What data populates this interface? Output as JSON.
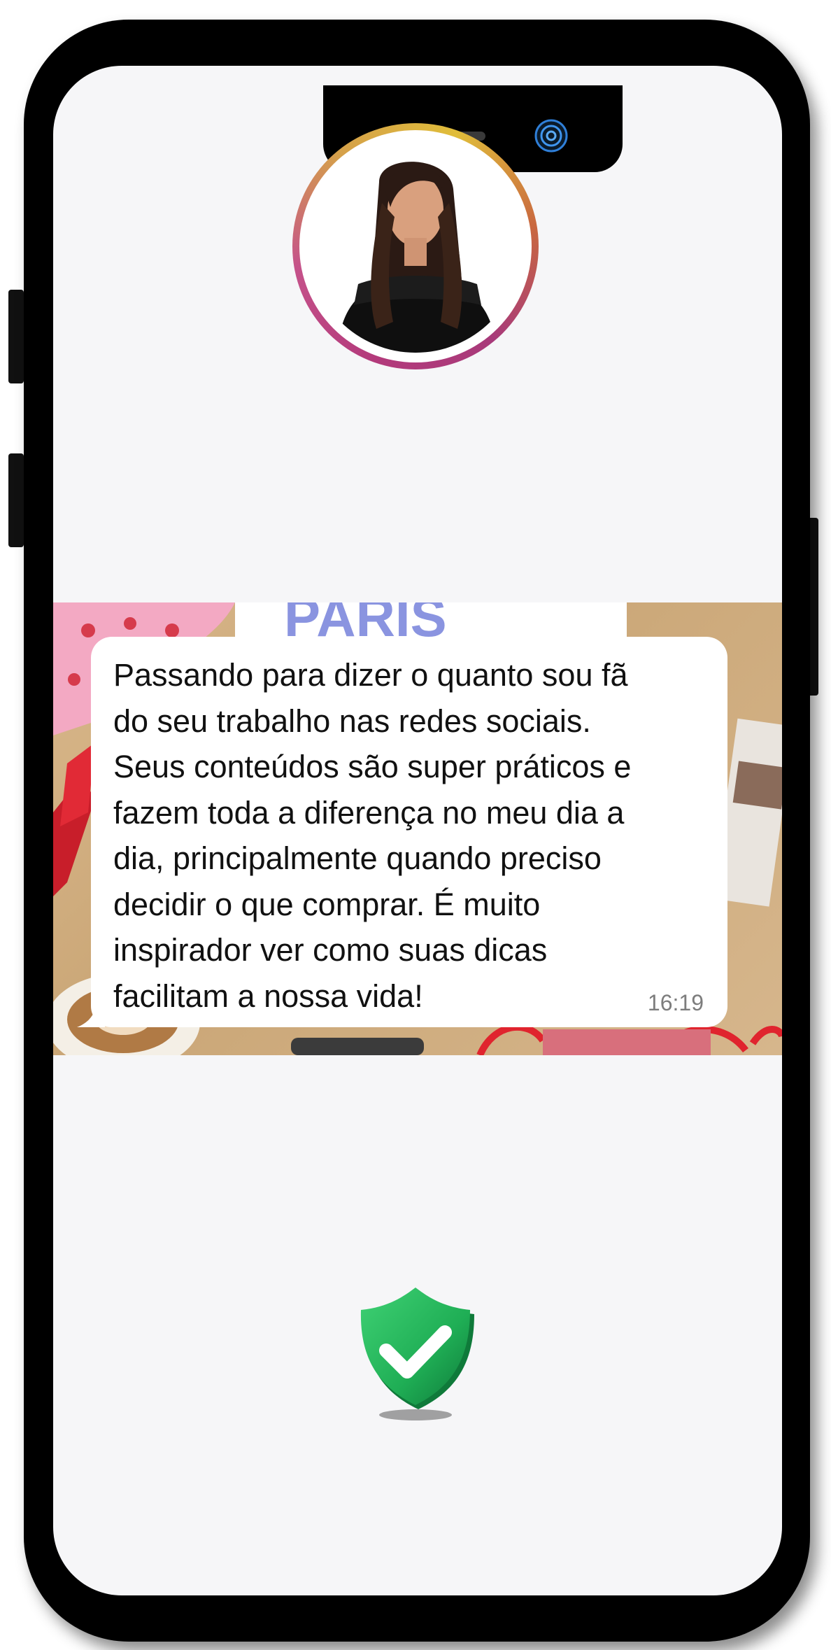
{
  "message": {
    "text_lines": [
      "Passando para dizer o quanto sou fã",
      "do seu trabalho nas redes sociais.",
      "Seus conteúdos são super práticos e",
      "fazem toda a diferença no meu dia a",
      "dia, principalmente quando preciso",
      "decidir o que comprar. É muito",
      "inspirador ver como suas dicas",
      "facilitam a nossa vida!"
    ],
    "time": "16:19"
  },
  "banner": {
    "visible_text": "PARIS"
  },
  "icons": {
    "avatar": "profile-photo",
    "verified": "verified-shield-check-icon",
    "camera": "front-camera-icon"
  },
  "colors": {
    "ring_start": "#b33a7b",
    "ring_end": "#e0bd3a",
    "shield_green": "#1fae55",
    "bubble_bg": "#ffffff",
    "screen_bg": "#f6f6f8"
  }
}
